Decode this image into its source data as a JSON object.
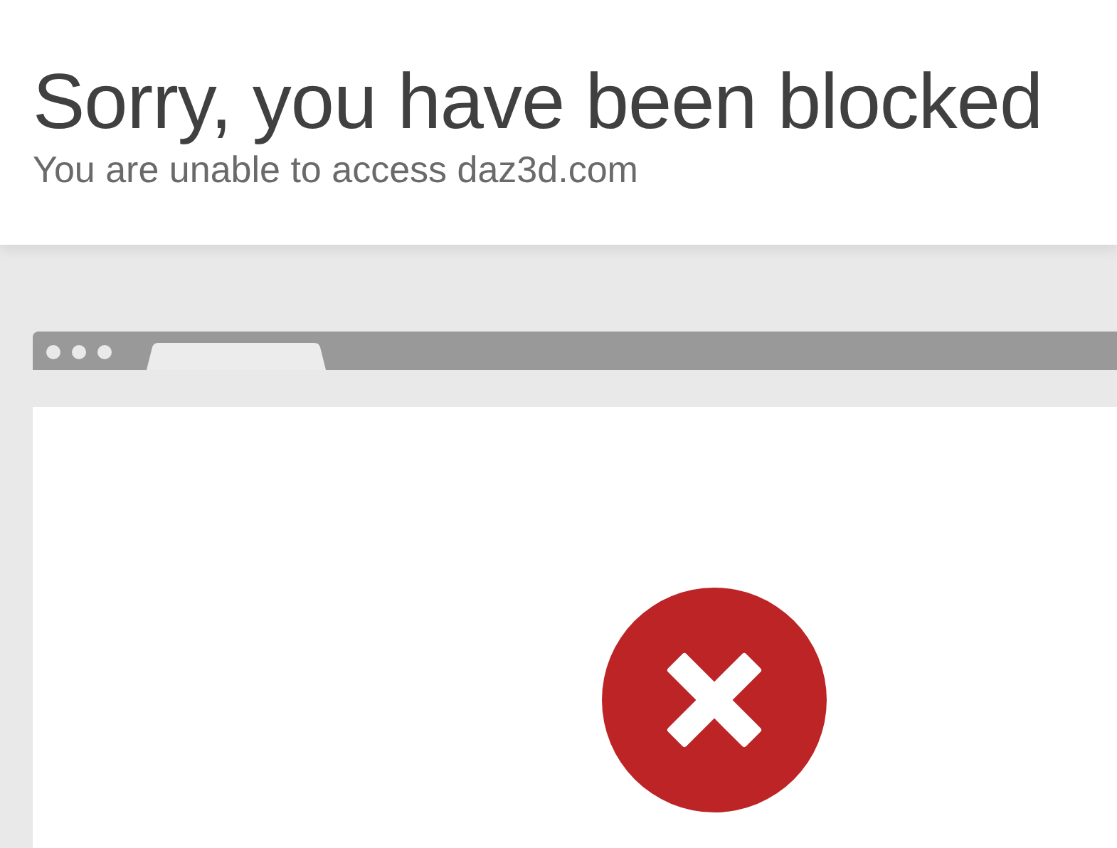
{
  "header": {
    "title": "Sorry, you have been blocked",
    "subtitle": "You are unable to access daz3d.com"
  }
}
